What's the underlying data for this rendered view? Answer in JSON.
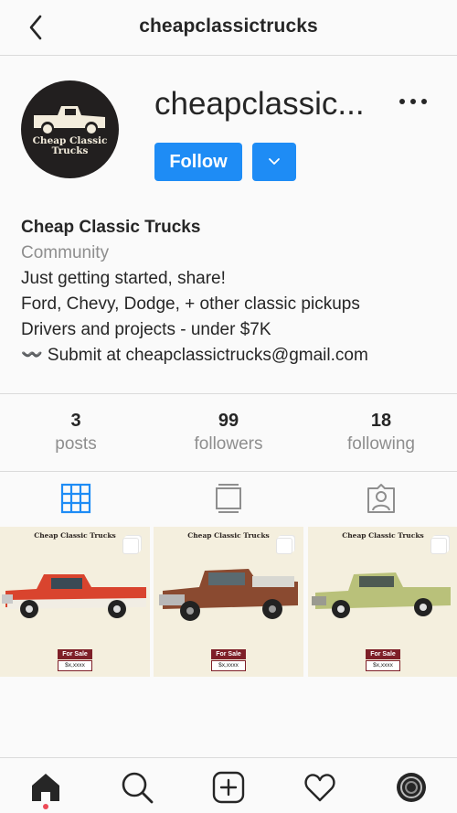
{
  "header": {
    "title": "cheapclassictrucks"
  },
  "profile": {
    "username_display": "cheapclassic...",
    "avatar_text": "Cheap Classic Trucks",
    "follow_label": "Follow",
    "full_name": "Cheap Classic Trucks",
    "category": "Community",
    "bio_lines": [
      "Just getting started, share!",
      "Ford, Chevy, Dodge, + other classic pickups",
      "Drivers and projects - under $7K",
      "〰️ Submit at cheapclassictrucks@gmail.com"
    ]
  },
  "stats": [
    {
      "value": "3",
      "label": "posts"
    },
    {
      "value": "99",
      "label": "followers"
    },
    {
      "value": "18",
      "label": "following"
    }
  ],
  "tabs": [
    {
      "icon": "grid-icon",
      "active": true
    },
    {
      "icon": "igtv-icon",
      "active": false
    },
    {
      "icon": "tagged-icon",
      "active": false
    }
  ],
  "posts": [
    {
      "title": "Cheap Classic Trucks",
      "badge": "For Sale",
      "price": "$x,xxxx",
      "truck_color": "#d9442e"
    },
    {
      "title": "Cheap Classic Trucks",
      "badge": "For Sale",
      "price": "$x,xxxx",
      "truck_color": "#8a4a30"
    },
    {
      "title": "Cheap Classic Trucks",
      "badge": "For Sale",
      "price": "$x,xxxx",
      "truck_color": "#b9c17a"
    }
  ],
  "colors": {
    "accent": "#1e8cf5",
    "muted": "#8e8e8e",
    "notification": "#ed4956"
  },
  "bottom_nav": [
    "home-icon",
    "search-icon",
    "new-post-icon",
    "activity-icon",
    "profile-avatar-icon"
  ]
}
